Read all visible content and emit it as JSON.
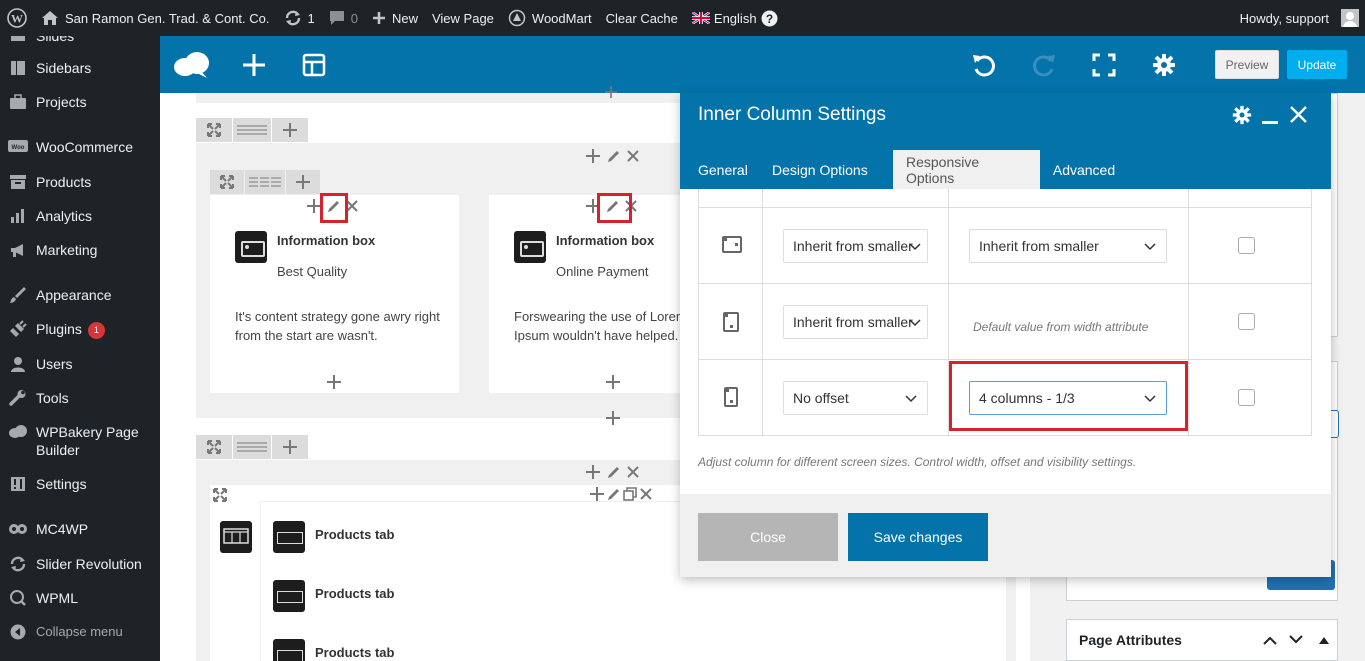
{
  "adminbar": {
    "site_name": "San Ramon Gen. Trad. & Cont. Co.",
    "updates_count": "1",
    "comments_count": "0",
    "new_label": "New",
    "view_page_label": "View Page",
    "woodmart_label": "WoodMart",
    "clear_cache_label": "Clear Cache",
    "language_label": "English",
    "howdy_label": "Howdy, support"
  },
  "sidebar": {
    "items": [
      {
        "label": "Slides",
        "icon": "slides-icon"
      },
      {
        "label": "Sidebars",
        "icon": "sidebars-icon"
      },
      {
        "label": "Projects",
        "icon": "briefcase-icon"
      },
      {
        "label": "WooCommerce",
        "icon": "woocommerce-icon"
      },
      {
        "label": "Products",
        "icon": "archive-icon"
      },
      {
        "label": "Analytics",
        "icon": "bar-chart-icon"
      },
      {
        "label": "Marketing",
        "icon": "megaphone-icon"
      },
      {
        "label": "Appearance",
        "icon": "paintbrush-icon"
      },
      {
        "label": "Plugins",
        "icon": "plug-icon",
        "badge": "1"
      },
      {
        "label": "Users",
        "icon": "user-icon"
      },
      {
        "label": "Tools",
        "icon": "wrench-icon"
      },
      {
        "label": "WPBakery Page Builder",
        "icon": "cloud-icon"
      },
      {
        "label": "Settings",
        "icon": "sliders-icon"
      },
      {
        "label": "MC4WP",
        "icon": "mc4wp-icon"
      },
      {
        "label": "Slider Revolution",
        "icon": "refresh-icon"
      },
      {
        "label": "WPML",
        "icon": "wpml-icon"
      },
      {
        "label": "Collapse menu",
        "icon": "collapse-icon"
      }
    ]
  },
  "toolbar": {
    "preview_label": "Preview",
    "update_label": "Update"
  },
  "canvas": {
    "info_boxes": [
      {
        "title": "Information box",
        "subtitle": "Best Quality",
        "text": "It's content strategy gone awry right from the start are wasn't."
      },
      {
        "title": "Information box",
        "subtitle": "Online Payment",
        "text": "Forswearing the use of Lorem Ipsum wouldn't have helped."
      }
    ],
    "product_tabs": [
      "Products tab",
      "Products tab",
      "Products tab"
    ]
  },
  "right_panel": {
    "page_attributes_label": "Page Attributes"
  },
  "modal": {
    "title": "Inner Column Settings",
    "tabs": [
      "General",
      "Design Options",
      "Responsive Options",
      "Advanced"
    ],
    "active_tab": "Responsive Options",
    "rows": [
      {
        "device": "landscape-tablet-icon",
        "offset": "Inherit from smaller",
        "width": "Inherit from smaller",
        "hidden": false
      },
      {
        "device": "portrait-tablet-icon",
        "offset": "Inherit from smaller",
        "width_hint": "Default value from width attribute",
        "hidden": false
      },
      {
        "device": "mobile-icon",
        "offset": "No offset",
        "width": "4 columns - 1/3",
        "hidden": false
      }
    ],
    "help_text": "Adjust column for different screen sizes. Control width, offset and visibility settings.",
    "close_label": "Close",
    "save_label": "Save changes"
  }
}
